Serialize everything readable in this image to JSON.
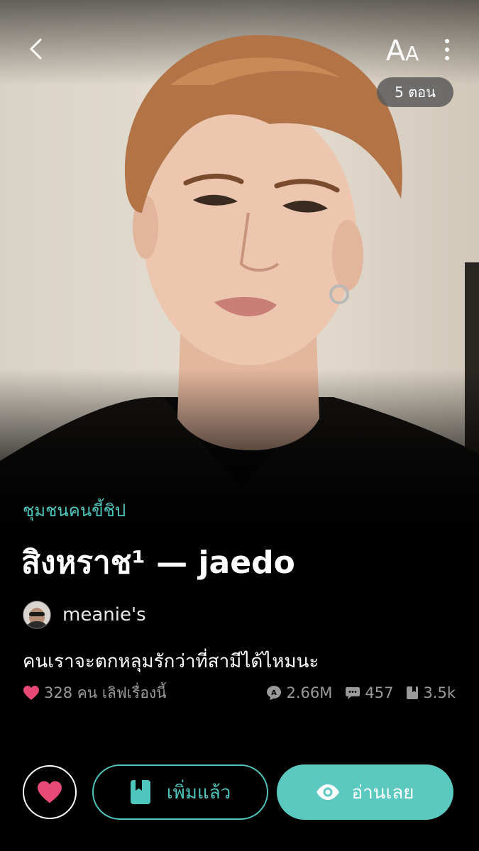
{
  "header": {
    "back_icon": "chevron-left-icon",
    "font_size_big": "A",
    "font_size_small": "A",
    "more_icon": "vertical-dots-icon",
    "episode_count": "5 ตอน"
  },
  "novel": {
    "category": "ชุมชนคนขี้ชิป",
    "title": "สิงหราช¹ — jaedo",
    "author": "meanie's",
    "tagline": "คนเราจะตกหลุมรักว่าที่สามีได้ไหมนะ"
  },
  "stats": {
    "likes_text": "328 คน เลิฟเรื่องนี้",
    "views": "2.66M",
    "comments": "457",
    "bookmarks": "3.5k"
  },
  "actions": {
    "added_label": "เพิ่มแล้ว",
    "read_label": "อ่านเลย"
  },
  "colors": {
    "accent": "#4fc6bd",
    "read_button_bg": "#5bc9bf",
    "heart": "#e84a78",
    "stats_text": "#9a9a9a"
  }
}
